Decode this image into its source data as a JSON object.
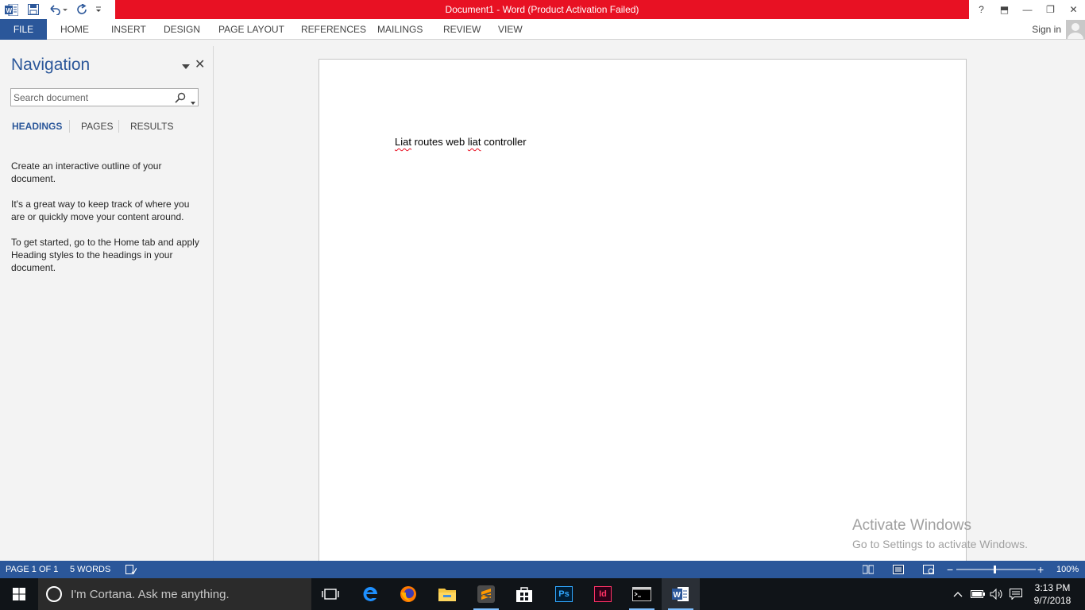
{
  "app": {
    "title": "Document1 -  Word (Product Activation Failed)",
    "brand_color": "#2b579a",
    "alert_color": "#e81123"
  },
  "window_controls": {
    "help": "?",
    "ribbon_display": "⬒",
    "minimize": "—",
    "restore": "❐",
    "close": "✕"
  },
  "ribbon": {
    "file": "FILE",
    "tabs": [
      "HOME",
      "INSERT",
      "DESIGN",
      "PAGE LAYOUT",
      "REFERENCES",
      "MAILINGS",
      "REVIEW",
      "VIEW"
    ],
    "sign_in": "Sign in"
  },
  "navigation": {
    "title": "Navigation",
    "search_placeholder": "Search document",
    "tabs": [
      "HEADINGS",
      "PAGES",
      "RESULTS"
    ],
    "paragraphs": [
      "Create an interactive outline of your document.",
      "It's a great way to keep track of where you are or quickly move your content around.",
      "To get started, go to the Home tab and apply Heading styles to the headings in your document."
    ]
  },
  "document": {
    "words": [
      "Liat",
      "routes",
      "web",
      "liat",
      "controller"
    ]
  },
  "watermark": {
    "line1": "Activate Windows",
    "line2": "Go to Settings to activate Windows."
  },
  "status": {
    "page": "PAGE 1 OF 1",
    "words": "5 WORDS",
    "zoom": "100%"
  },
  "taskbar": {
    "cortana_text": "I'm Cortana. Ask me anything.",
    "time": "3:13 PM",
    "date": "9/7/2018",
    "apps": [
      "task-view",
      "edge",
      "firefox",
      "file-explorer",
      "sublime-text",
      "store",
      "photoshop",
      "indesign",
      "command-prompt",
      "word"
    ],
    "ps_label": "Ps",
    "id_label": "Id"
  }
}
